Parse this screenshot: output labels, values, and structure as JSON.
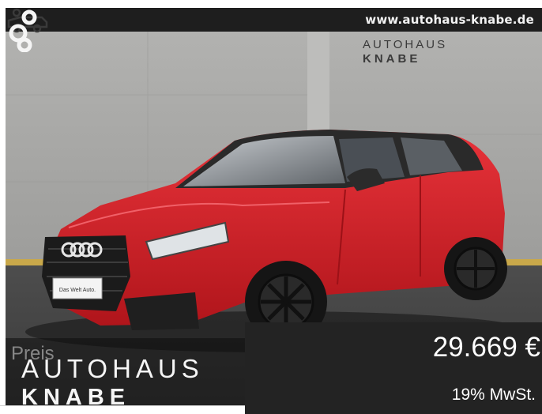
{
  "banner": {
    "url": "www.autohaus-knabe.de"
  },
  "watermark_logo": {
    "line1": "AUTOHAUS",
    "line2": "KNABE",
    "icon": "car-trailer-icon"
  },
  "overlay": {
    "label": "Preis",
    "logo_line1": "AUTOHAUS",
    "logo_line2": "KNABE",
    "logo_icon": "car-trailer-icon"
  },
  "price": {
    "amount": "29.669 €",
    "vat_note": "19% MwSt."
  },
  "photo": {
    "subject": "red-compact-suv-icon",
    "plate_text": "Das Welt Auto."
  },
  "colors": {
    "car": "#d81f26",
    "bar": "#1e1e1e",
    "price_box": "#232323",
    "wall": "#a9a9a7"
  }
}
